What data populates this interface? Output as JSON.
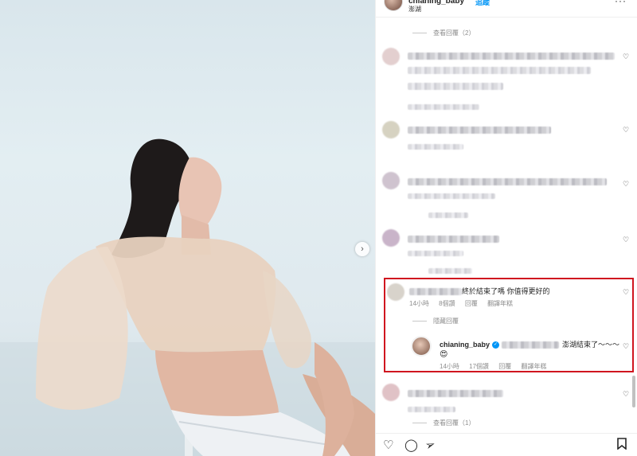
{
  "header": {
    "username": "chianing_baby",
    "follow_label": "追蹤",
    "location": "澎湖",
    "more_icon": "more-icon"
  },
  "comments": {
    "view_replies_top": "查看回覆（2）",
    "view_replies_bottom": "查看回覆（1）",
    "highlighted": {
      "text": "終於結束了嗎 你值得更好的",
      "time": "14小時",
      "likes": "8個讚",
      "reply": "回覆",
      "translate": "翻譯年糕"
    },
    "hide_replies": "隱藏回覆",
    "owner_reply": {
      "username": "chianing_baby",
      "text": "澎湖結束了～～～",
      "emoji": "😍",
      "time": "14小時",
      "likes": "17個讚",
      "reply": "回覆",
      "translate": "翻譯年糕"
    }
  },
  "colors": {
    "highlight_border": "#d0161f",
    "link_blue": "#0095f6",
    "muted": "#8e8e8e"
  },
  "icons": [
    "heart-icon",
    "comment-icon",
    "share-icon",
    "bookmark-icon",
    "chevron-right-icon",
    "verified-icon"
  ]
}
